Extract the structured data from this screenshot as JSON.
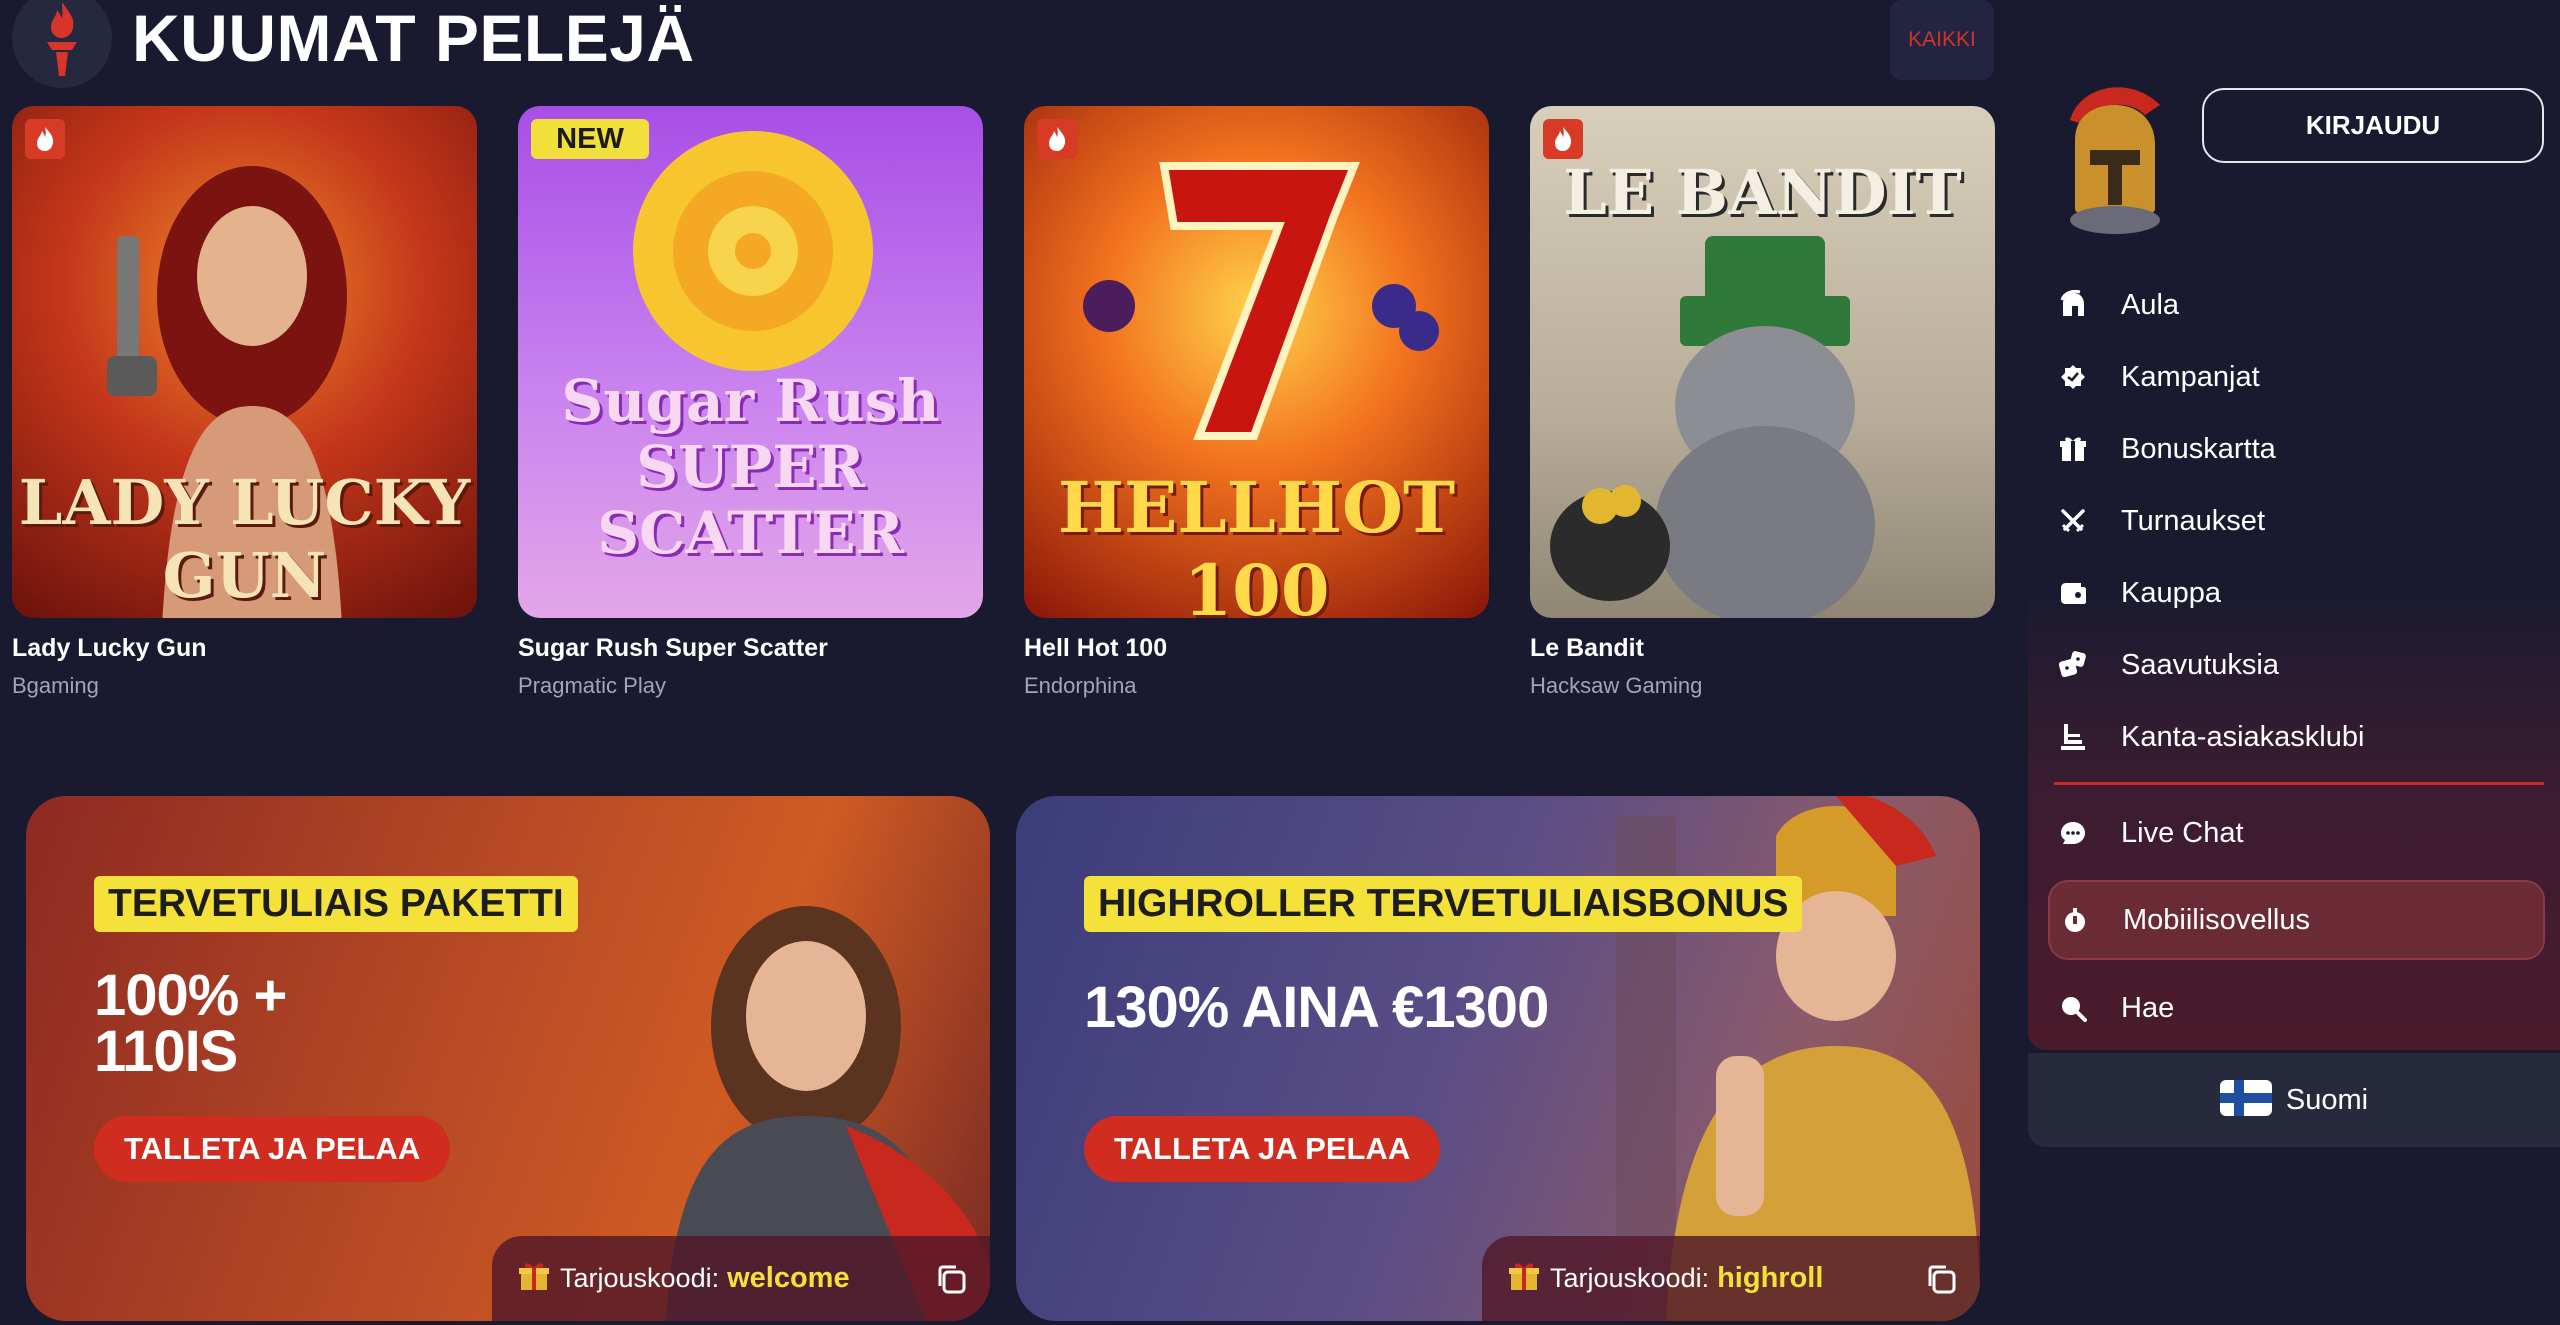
{
  "header": {
    "title": "KUUMAT PELEJÄ",
    "see_all": "KAIKKI"
  },
  "games": [
    {
      "name": "Lady Lucky Gun",
      "provider": "Bgaming",
      "badge": "fire",
      "thumb_text": "LADY LUCKY GUN"
    },
    {
      "name": "Sugar Rush Super Scatter",
      "provider": "Pragmatic Play",
      "badge": "NEW",
      "thumb_text": "Sugar Rush SUPER SCATTER"
    },
    {
      "name": "Hell Hot 100",
      "provider": "Endorphina",
      "badge": "fire",
      "thumb_text": "HELLHOT 100"
    },
    {
      "name": "Le Bandit",
      "provider": "Hacksaw Gaming",
      "badge": "fire",
      "thumb_text": "LE BANDIT"
    }
  ],
  "promos": [
    {
      "tag": "TERVETULIAIS PAKETTI",
      "headline_1": "100% +",
      "headline_2": "110IS",
      "button": "TALLETA JA PELAA",
      "code_label": "Tarjouskoodi:",
      "code": "welcome"
    },
    {
      "tag": "HIGHROLLER TERVETULIAISBONUS",
      "headline_1": "130% AINA €1300",
      "button": "TALLETA JA PELAA",
      "code_label": "Tarjouskoodi:",
      "code": "highroll"
    }
  ],
  "sidebar": {
    "login": "KIRJAUDU",
    "items": [
      {
        "label": "Aula",
        "icon": "helmet-icon"
      },
      {
        "label": "Kampanjat",
        "icon": "badge-icon"
      },
      {
        "label": "Bonuskartta",
        "icon": "gift-icon"
      },
      {
        "label": "Turnaukset",
        "icon": "crossed-swords-icon"
      },
      {
        "label": "Kauppa",
        "icon": "wallet-icon"
      },
      {
        "label": "Saavutuksia",
        "icon": "dice-icon"
      },
      {
        "label": "Kanta-asiakasklubi",
        "icon": "podium-icon"
      },
      {
        "label": "Live Chat",
        "icon": "chat-icon"
      },
      {
        "label": "Mobiilisovellus",
        "icon": "mobile-app-icon"
      },
      {
        "label": "Hae",
        "icon": "search-icon"
      }
    ],
    "language": "Suomi"
  },
  "colors": {
    "background": "#191a30",
    "accent_red": "#d02c20",
    "accent_yellow": "#f4e13a"
  }
}
